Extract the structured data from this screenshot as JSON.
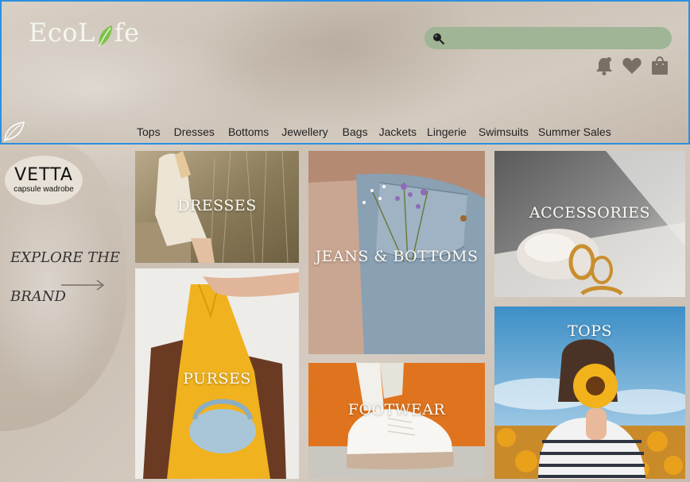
{
  "header": {
    "logo_text_left": "Eco",
    "logo_text_mid": "L",
    "logo_text_right": "fe",
    "search_placeholder": "",
    "icons": [
      "notification-bell-icon",
      "heart-icon",
      "shopping-bag-icon"
    ]
  },
  "nav": {
    "items": [
      "Tops",
      "Dresses",
      "Bottoms",
      "Jewellery",
      "Bags",
      "Jackets",
      "Lingerie",
      "Swimsuits",
      "Summer Sales"
    ]
  },
  "left_panel": {
    "brand_name": "VETTA",
    "brand_tagline": "capsule wadrobe",
    "explore_line1": "EXPLORE THE",
    "explore_line2": "BRAND"
  },
  "categories": {
    "dresses": "DRESSES",
    "purses": "PURSES",
    "jeans": "JEANS & BOTTOMS",
    "footwear": "FOOTWEAR",
    "accessories": "ACCESSORIES",
    "tops": "TOPS"
  },
  "colors": {
    "search_bg": "#9fb596",
    "logo": "#f4f6ef",
    "header_border": "#2d8fe0"
  }
}
